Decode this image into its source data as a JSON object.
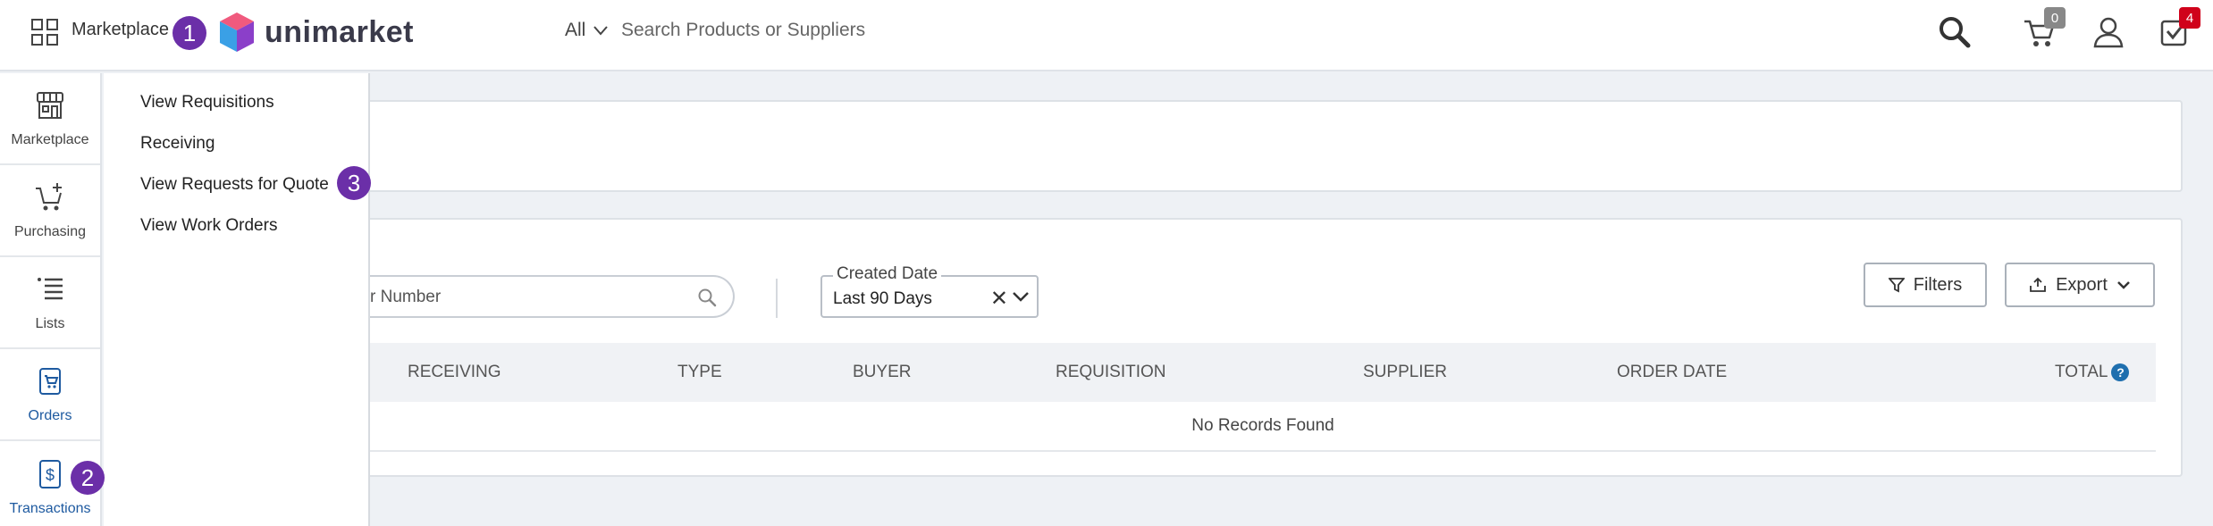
{
  "header": {
    "switcher_label": "Marketplace",
    "logo_text": "unimarket",
    "search_scope": "All",
    "search_placeholder": "Search Products or Suppliers",
    "cart_count": "0",
    "tasks_count": "4"
  },
  "steps": [
    "1",
    "2",
    "3"
  ],
  "rail": {
    "items": [
      {
        "label": "Marketplace",
        "icon": "storefront-icon"
      },
      {
        "label": "Purchasing",
        "icon": "cart-add-icon"
      },
      {
        "label": "Lists",
        "icon": "list-icon"
      },
      {
        "label": "Orders",
        "icon": "orders-icon"
      },
      {
        "label": "Transactions",
        "icon": "transactions-icon"
      }
    ]
  },
  "menu": {
    "items": [
      "View Requisitions",
      "Receiving",
      "View Requests for Quote",
      "View Work Orders"
    ]
  },
  "filters": {
    "search_placeholder": "r Number",
    "date_legend": "Created Date",
    "date_value": "Last 90 Days",
    "clear_glyph": "✕",
    "filters_label": "Filters",
    "export_label": "Export"
  },
  "table": {
    "columns": [
      "RECEIVING",
      "TYPE",
      "BUYER",
      "REQUISITION",
      "SUPPLIER",
      "ORDER DATE",
      "TOTAL"
    ],
    "help_glyph": "?",
    "empty_text": "No Records Found"
  },
  "colors": {
    "accent_purple": "#6b2fa8",
    "link_blue": "#1e5aa0",
    "badge_red": "#d0021b",
    "badge_gray": "#888888"
  }
}
